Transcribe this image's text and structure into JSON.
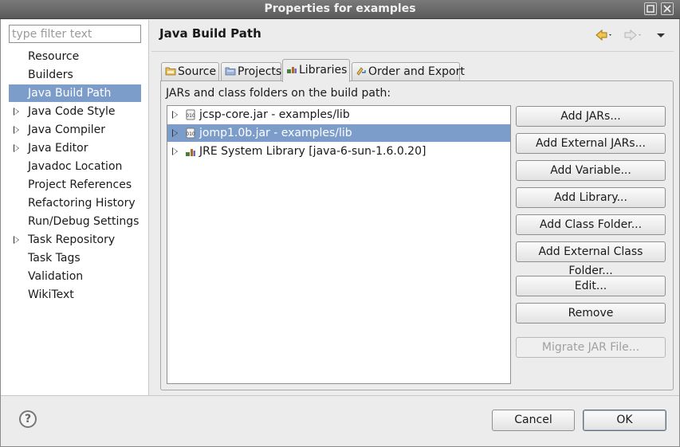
{
  "window": {
    "title": "Properties for examples",
    "buttons": [
      "restore",
      "close"
    ]
  },
  "filter": {
    "placeholder": "type filter text",
    "value": ""
  },
  "nav": {
    "items": [
      {
        "label": "Resource",
        "expandable": false,
        "selected": false
      },
      {
        "label": "Builders",
        "expandable": false,
        "selected": false
      },
      {
        "label": "Java Build Path",
        "expandable": false,
        "selected": true
      },
      {
        "label": "Java Code Style",
        "expandable": true,
        "selected": false
      },
      {
        "label": "Java Compiler",
        "expandable": true,
        "selected": false
      },
      {
        "label": "Java Editor",
        "expandable": true,
        "selected": false
      },
      {
        "label": "Javadoc Location",
        "expandable": false,
        "selected": false
      },
      {
        "label": "Project References",
        "expandable": false,
        "selected": false
      },
      {
        "label": "Refactoring History",
        "expandable": false,
        "selected": false
      },
      {
        "label": "Run/Debug Settings",
        "expandable": false,
        "selected": false
      },
      {
        "label": "Task Repository",
        "expandable": true,
        "selected": false
      },
      {
        "label": "Task Tags",
        "expandable": false,
        "selected": false
      },
      {
        "label": "Validation",
        "expandable": false,
        "selected": false
      },
      {
        "label": "WikiText",
        "expandable": false,
        "selected": false
      }
    ]
  },
  "page": {
    "title": "Java Build Path",
    "back_icon": "back-arrow-icon",
    "forward_icon": "forward-arrow-icon",
    "menu_icon": "view-menu-icon"
  },
  "tabs": [
    {
      "label": "Source",
      "icon": "source-folder-icon",
      "active": false
    },
    {
      "label": "Projects",
      "icon": "projects-icon",
      "active": false
    },
    {
      "label": "Libraries",
      "icon": "libraries-icon",
      "active": true
    },
    {
      "label": "Order and Export",
      "icon": "order-export-icon",
      "active": false
    }
  ],
  "libraries": {
    "label": "JARs and class folders on the build path:",
    "entries": [
      {
        "label": "jcsp-core.jar - examples/lib",
        "icon": "jar-icon",
        "selected": false
      },
      {
        "label": "jomp1.0b.jar - examples/lib",
        "icon": "jar-icon",
        "selected": true
      },
      {
        "label": "JRE System Library [java-6-sun-1.6.0.20]",
        "icon": "library-icon",
        "selected": false
      }
    ],
    "buttons": {
      "add_jars": "Add JARs...",
      "add_external_jars": "Add External JARs...",
      "add_variable": "Add Variable...",
      "add_library": "Add Library...",
      "add_class_folder": "Add Class Folder...",
      "add_external_class_folder": "Add External Class Folder...",
      "edit": "Edit...",
      "remove": "Remove",
      "migrate_jar": "Migrate JAR File..."
    }
  },
  "footer": {
    "help_label": "?",
    "cancel": "Cancel",
    "ok": "OK"
  },
  "colors": {
    "selection": "#7c9cca",
    "titlebar": "#6a6a6a",
    "background": "#ececec"
  }
}
